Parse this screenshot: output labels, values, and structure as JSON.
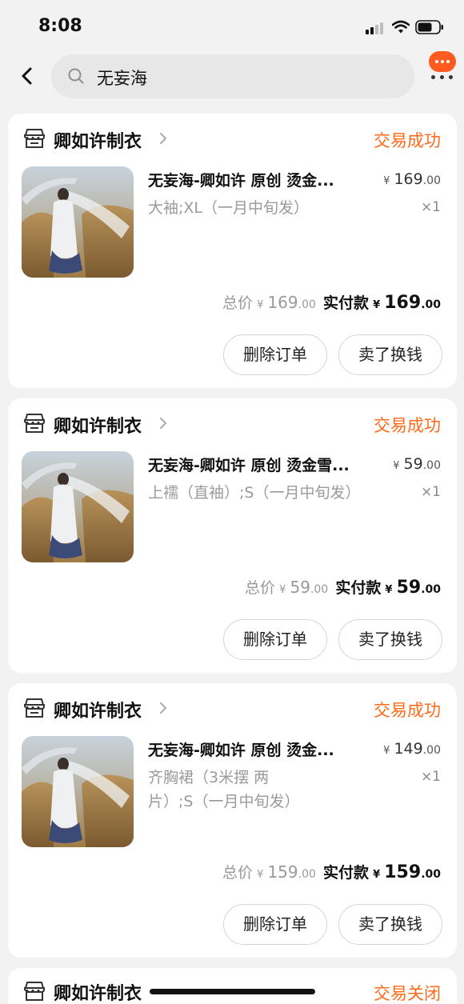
{
  "status_bar": {
    "time": "8:08"
  },
  "search": {
    "query": "无妄海"
  },
  "orders": [
    {
      "shop_name": "卿如许制衣",
      "status": "交易成功",
      "title": "无妄海-卿如许 原创 烫金...",
      "sku": "大袖;XL（一月中旬发）",
      "unit_price_int": "169",
      "unit_price_dec": ".00",
      "quantity": "×1",
      "total_label": "总价",
      "total_int": "169",
      "total_dec": ".00",
      "paid_label": "实付款",
      "paid_int": "169",
      "paid_dec": ".00",
      "delete_label": "删除订单",
      "resell_label": "卖了换钱"
    },
    {
      "shop_name": "卿如许制衣",
      "status": "交易成功",
      "title": "无妄海-卿如许 原创 烫金雪...",
      "sku": "上襦（直袖）;S（一月中旬发）",
      "unit_price_int": "59",
      "unit_price_dec": ".00",
      "quantity": "×1",
      "total_label": "总价",
      "total_int": "59",
      "total_dec": ".00",
      "paid_label": "实付款",
      "paid_int": "59",
      "paid_dec": ".00",
      "delete_label": "删除订单",
      "resell_label": "卖了换钱"
    },
    {
      "shop_name": "卿如许制衣",
      "status": "交易成功",
      "title": "无妄海-卿如许 原创 烫金...",
      "sku": "齐胸裙（3米摆 两片）;S（一月中旬发）",
      "unit_price_int": "149",
      "unit_price_dec": ".00",
      "quantity": "×1",
      "total_label": "总价",
      "total_int": "159",
      "total_dec": ".00",
      "paid_label": "实付款",
      "paid_int": "159",
      "paid_dec": ".00",
      "delete_label": "删除订单",
      "resell_label": "卖了换钱"
    }
  ],
  "partial_order": {
    "shop_name": "卿如许制衣",
    "status": "交易关闭"
  },
  "currency_symbol": "¥",
  "colors": {
    "accent": "#ff6a1a",
    "background": "#f2f2f2",
    "card": "#ffffff",
    "badge": "#ff5a1f"
  },
  "icons": {
    "back": "back-chevron-icon",
    "search": "search-icon",
    "shop": "shop-icon",
    "more": "more-icon",
    "message": "message-badge-icon"
  }
}
